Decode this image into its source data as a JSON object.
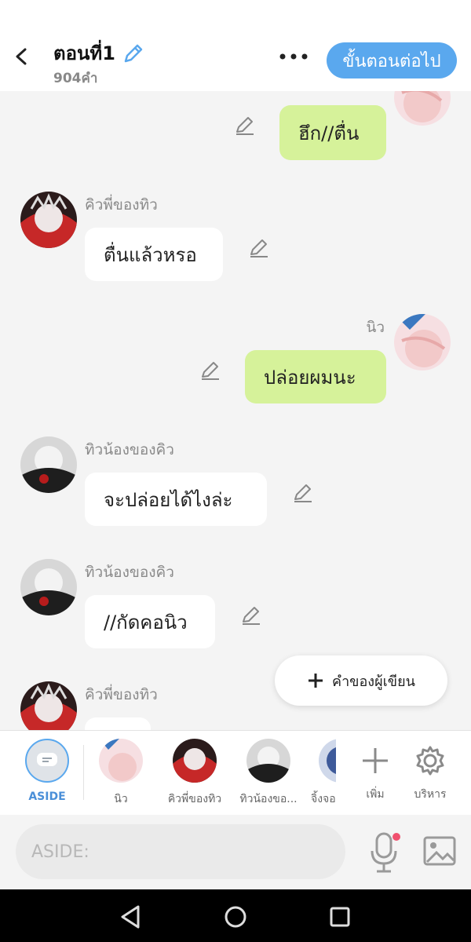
{
  "header": {
    "title": "ตอนที่1",
    "word_count": "904คำ",
    "next_button": "ขั้นตอนต่อไป"
  },
  "messages": [
    {
      "side": "right",
      "text": "ฮึก//ตื่น"
    },
    {
      "side": "left",
      "name": "คิวพี่ของทิว",
      "text": "ตื่นแล้วหรอ"
    },
    {
      "side": "right",
      "name": "นิว",
      "text": "ปล่อยผมนะ"
    },
    {
      "side": "left",
      "name": "ทิวน้องของคิว",
      "text": "จะปล่อยได้ไงล่ะ"
    },
    {
      "side": "left",
      "name": "ทิวน้องของคิว",
      "text": "//กัดคอนิว"
    },
    {
      "side": "left",
      "name": "คิวพี่ของทิว",
      "text": ""
    }
  ],
  "writer_button": "คำของผู้เขียน",
  "characters": [
    {
      "label": "ASIDE"
    },
    {
      "label": "นิว"
    },
    {
      "label": "คิวพี่ของทิว"
    },
    {
      "label": "ทิวน้องขอ..."
    },
    {
      "label": "จิ้งจอ"
    }
  ],
  "actions": {
    "add": "เพิ่ม",
    "manage": "บริหาร"
  },
  "input": {
    "placeholder": "ASIDE:"
  },
  "colors": {
    "accent": "#5aa8ee",
    "right_bubble": "#d6f29a",
    "left_bubble": "#ffffff",
    "background": "#f4f4f4"
  }
}
